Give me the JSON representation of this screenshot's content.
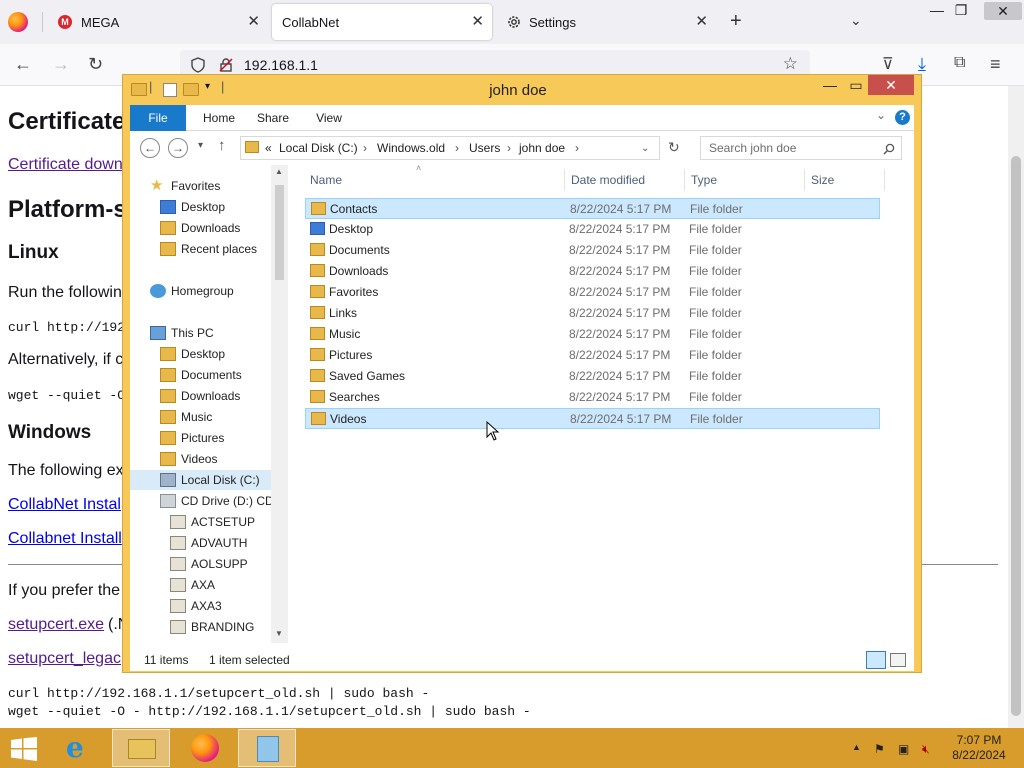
{
  "browser": {
    "tabs": [
      {
        "label": "MEGA",
        "icon": "mega-icon"
      },
      {
        "label": "CollabNet",
        "active": true
      },
      {
        "label": "Settings",
        "icon": "gear-icon"
      }
    ],
    "url": "192.168.1.1"
  },
  "webpage": {
    "h1_cert": "Certificate",
    "link_cert_download": "Certificate down",
    "h1_platform": "Platform-s",
    "h2_linux": "Linux",
    "p_run": "Run the followin",
    "code_curl": "curl http://192.",
    "p_alt": "Alternatively, if c",
    "code_wget": "wget --quiet -O",
    "h2_windows": "Windows",
    "p_following": "The following ex",
    "link_install1": "CollabNet Instal",
    "link_install2": "Collabnet Install",
    "p_prefer": "If you prefer the",
    "link_setupcert": "setupcert.exe",
    "setupcert_suffix": "(.N",
    "link_legacy": "setupcert_legac",
    "code_old_curl": "curl http://192.168.1.1/setupcert_old.sh | sudo bash -",
    "code_old_wget": "wget --quiet -O - http://192.168.1.1/setupcert_old.sh | sudo bash -"
  },
  "explorer": {
    "title": "john doe",
    "ribbon_tabs": [
      "File",
      "Home",
      "Share",
      "View"
    ],
    "breadcrumb": [
      "«",
      "Local Disk (C:)",
      "Windows.old",
      "Users",
      "john doe"
    ],
    "search_placeholder": "Search john doe",
    "nav": {
      "favorites": "Favorites",
      "fav_items": [
        "Desktop",
        "Downloads",
        "Recent places"
      ],
      "homegroup": "Homegroup",
      "thispc": "This PC",
      "pc_items": [
        "Desktop",
        "Documents",
        "Downloads",
        "Music",
        "Pictures",
        "Videos"
      ],
      "local_disk": "Local Disk (C:)",
      "cd_drive": "CD Drive (D:) CDI",
      "cd_items": [
        "ACTSETUP",
        "ADVAUTH",
        "AOLSUPP",
        "AXA",
        "AXA3",
        "BRANDING"
      ]
    },
    "columns": [
      "Name",
      "Date modified",
      "Type",
      "Size"
    ],
    "files": [
      {
        "name": "Contacts",
        "date": "8/22/2024 5:17 PM",
        "type": "File folder",
        "selected": true
      },
      {
        "name": "Desktop",
        "date": "8/22/2024 5:17 PM",
        "type": "File folder"
      },
      {
        "name": "Documents",
        "date": "8/22/2024 5:17 PM",
        "type": "File folder"
      },
      {
        "name": "Downloads",
        "date": "8/22/2024 5:17 PM",
        "type": "File folder"
      },
      {
        "name": "Favorites",
        "date": "8/22/2024 5:17 PM",
        "type": "File folder"
      },
      {
        "name": "Links",
        "date": "8/22/2024 5:17 PM",
        "type": "File folder"
      },
      {
        "name": "Music",
        "date": "8/22/2024 5:17 PM",
        "type": "File folder"
      },
      {
        "name": "Pictures",
        "date": "8/22/2024 5:17 PM",
        "type": "File folder"
      },
      {
        "name": "Saved Games",
        "date": "8/22/2024 5:17 PM",
        "type": "File folder"
      },
      {
        "name": "Searches",
        "date": "8/22/2024 5:17 PM",
        "type": "File folder"
      },
      {
        "name": "Videos",
        "date": "8/22/2024 5:17 PM",
        "type": "File folder",
        "hover": true
      }
    ],
    "status_count": "11 items",
    "status_selected": "1 item selected"
  },
  "taskbar": {
    "time": "7:07 PM",
    "date": "8/22/2024"
  },
  "colors": {
    "explorer_frame": "#f6c958",
    "taskbar": "#d89c2c",
    "selection": "#cce8ff",
    "ribbon_file": "#1979ca"
  }
}
